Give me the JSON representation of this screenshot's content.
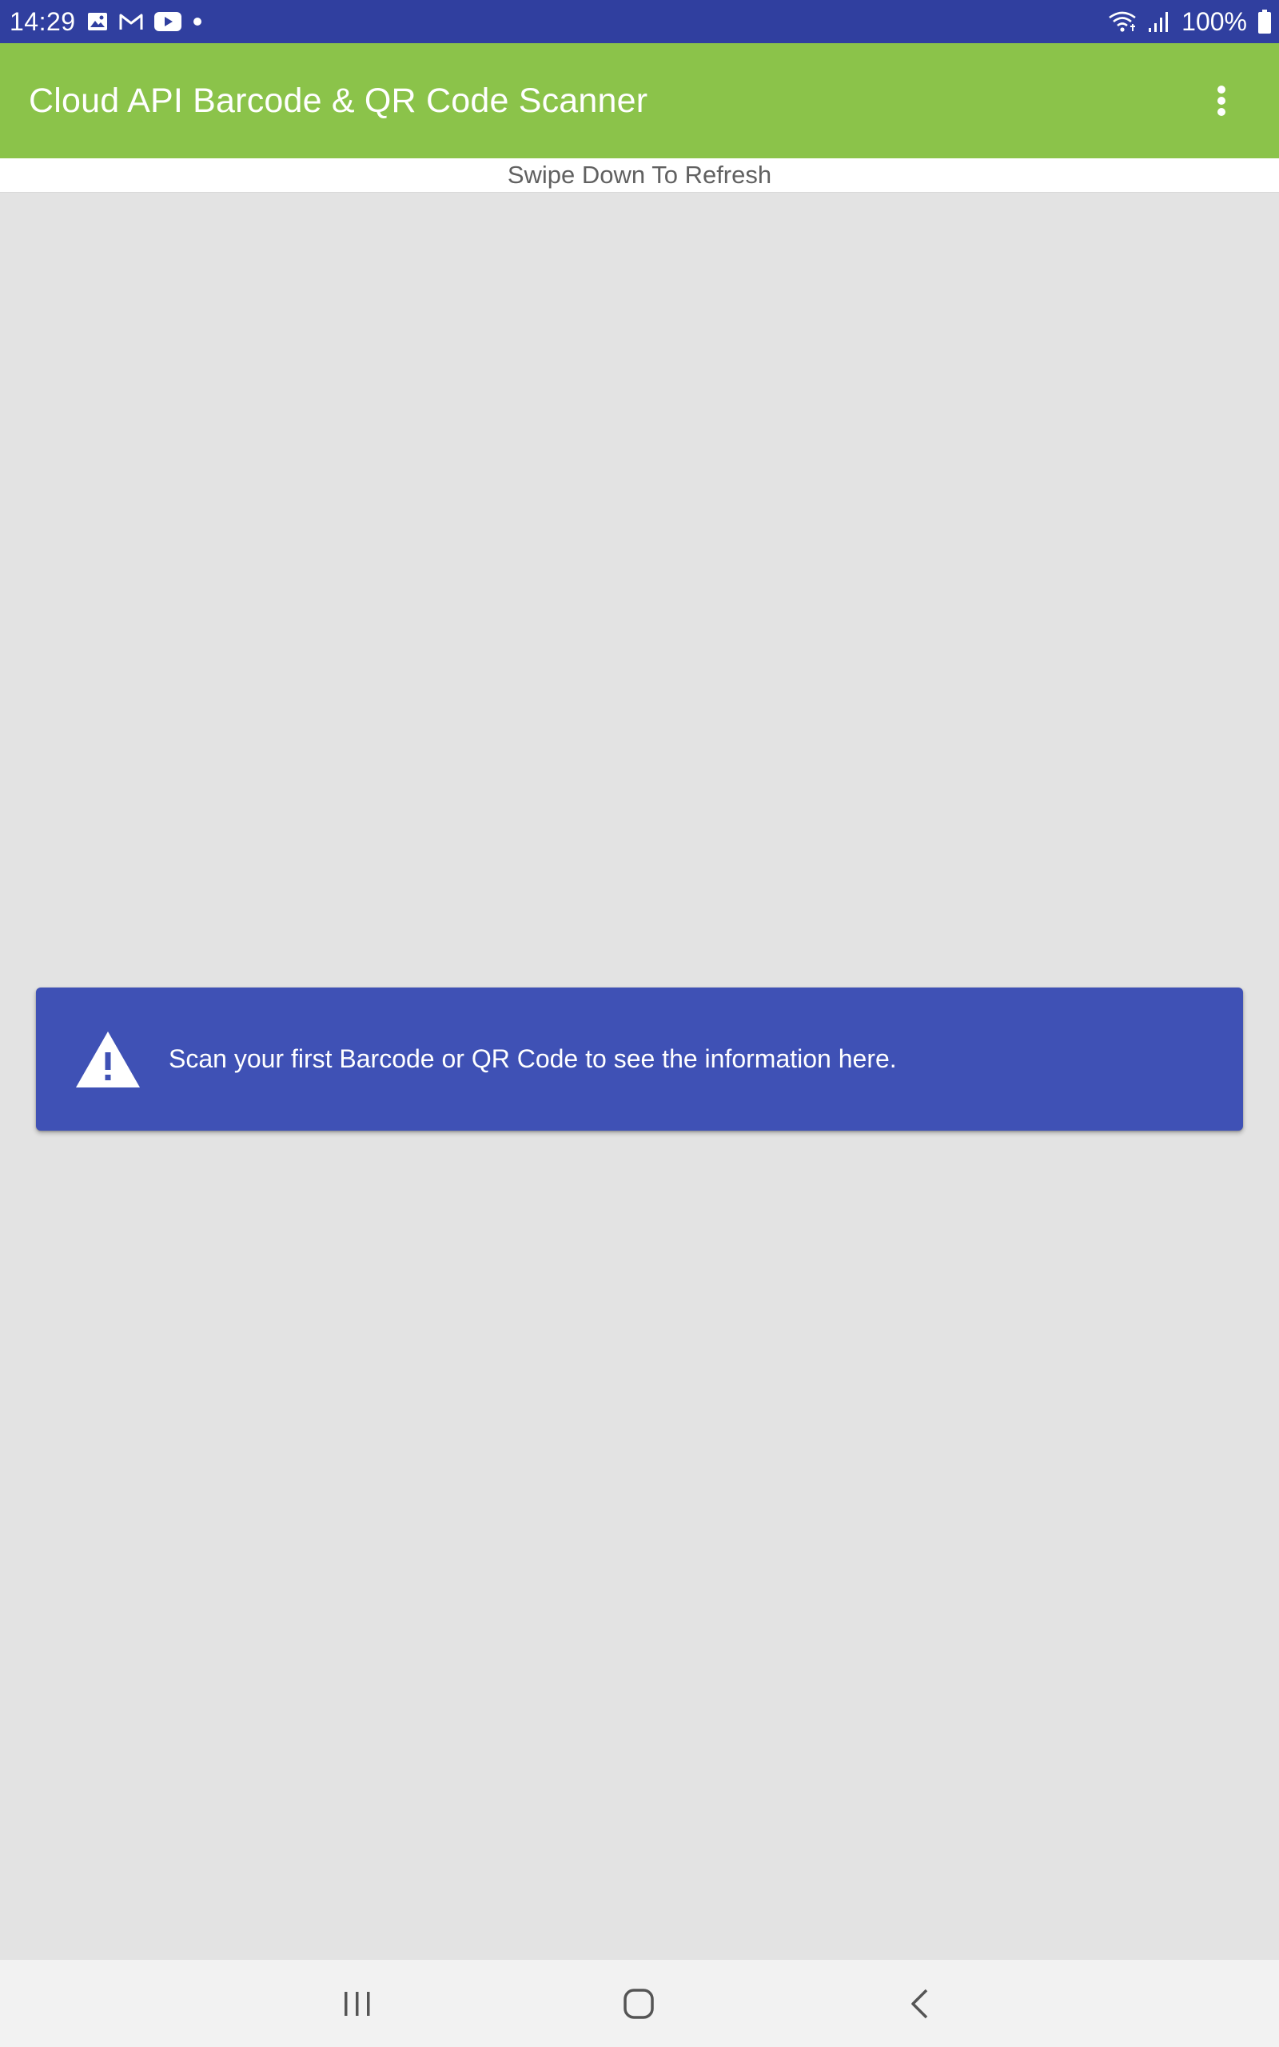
{
  "status_bar": {
    "time": "14:29",
    "left_icons": [
      "gallery-icon",
      "gmail-icon",
      "youtube-icon",
      "notification-dot-icon"
    ],
    "right_icons": [
      "wifi-icon",
      "signal-icon",
      "battery-icon"
    ],
    "battery": "100%"
  },
  "app_bar": {
    "title": "Cloud API Barcode & QR Code Scanner",
    "menu_icon": "more-vert-icon"
  },
  "swipe_hint": "Swipe Down To Refresh",
  "info_card": {
    "icon": "warning-icon",
    "message": "Scan your first Barcode or QR Code to see the information here."
  },
  "nav_bar": {
    "buttons": [
      "recents-icon",
      "home-icon",
      "back-icon"
    ]
  },
  "colors": {
    "status_bar": "#303f9f",
    "app_bar": "#8bc34a",
    "card": "#3f51b5",
    "background": "#e3e3e3",
    "nav_bar": "#f2f2f2"
  }
}
